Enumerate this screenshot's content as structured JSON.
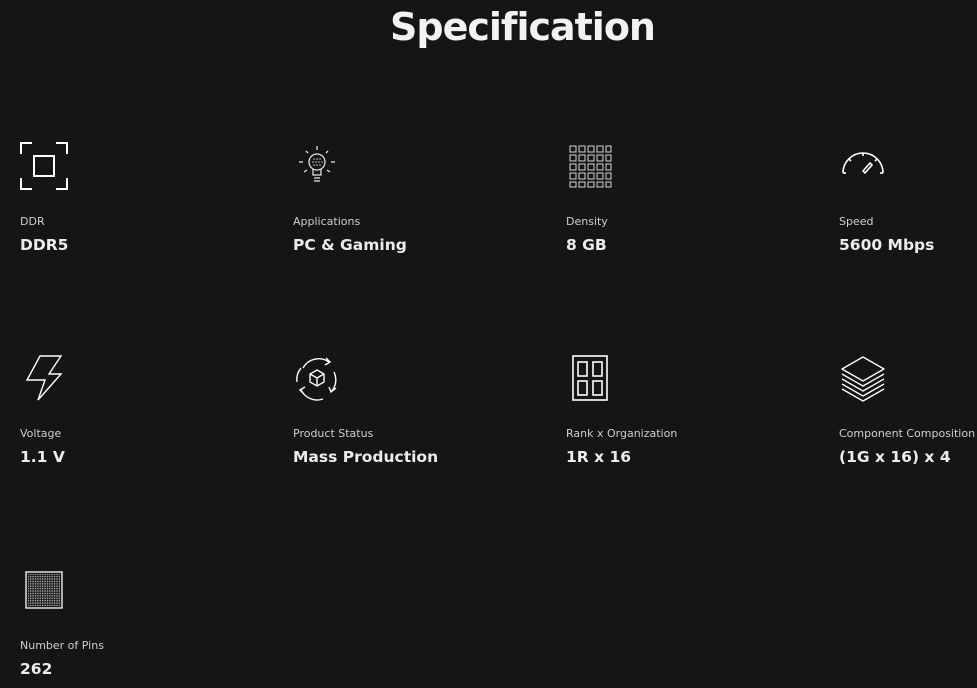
{
  "page": {
    "title": "Specification"
  },
  "specs": [
    {
      "icon": "ddr-frame-icon",
      "label": "DDR",
      "value": "DDR5"
    },
    {
      "icon": "lightbulb-icon",
      "label": "Applications",
      "value": "PC & Gaming"
    },
    {
      "icon": "density-grid-icon",
      "label": "Density",
      "value": "8 GB"
    },
    {
      "icon": "speedometer-icon",
      "label": "Speed",
      "value": "5600 Mbps"
    },
    {
      "icon": "lightning-bolt-icon",
      "label": "Voltage",
      "value": "1.1 V"
    },
    {
      "icon": "production-cycle-icon",
      "label": "Product Status",
      "value": "Mass Production"
    },
    {
      "icon": "rank-organization-icon",
      "label": "Rank x Organization",
      "value": "1R x 16"
    },
    {
      "icon": "layers-stack-icon",
      "label": "Component Composition",
      "value": "(1G x 16) x 4"
    },
    {
      "icon": "pin-chip-icon",
      "label": "Number of Pins",
      "value": "262"
    }
  ]
}
